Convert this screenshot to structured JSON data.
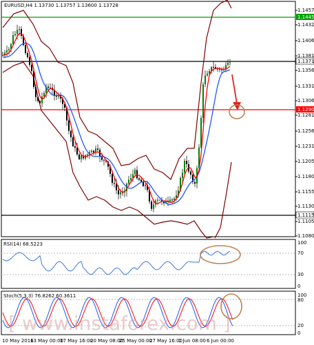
{
  "main_panel": {
    "header": "EURUSD,H4  1.13730 1.13757 1.13600 1.13728",
    "price_labels": [
      "1.14570",
      "1.14320",
      "1.14065",
      "1.13815",
      "1.13565",
      "1.13315",
      "1.13065",
      "1.12810",
      "1.12560",
      "1.12310",
      "1.12055",
      "1.11805",
      "1.11555",
      "1.11300",
      "1.11050",
      "1.10800"
    ],
    "level_green": "1.14454",
    "level_black_top": "1.13713",
    "level_red": "1.12904",
    "level_black_bottom": "1.11150"
  },
  "rsi_panel": {
    "header": "RSI(14) 68.5223",
    "scale": [
      "100",
      "70",
      "30",
      "0"
    ]
  },
  "stoch_panel": {
    "header": "Stoch(5,3,3) 76.8262 60.3611",
    "scale": [
      "100",
      "80",
      "20",
      "0"
    ]
  },
  "time_labels": [
    "10 May 2016",
    "13 May 00:00",
    "17 May 16:00",
    "20 May 08:00",
    "25 May 00:00",
    "27 May 16:00",
    "1 Jun 08:00",
    "6 Jun 00:00"
  ],
  "watermark": "[ www.instaforex.com ]",
  "colors": {
    "candle": "#008000",
    "ma_red": "#ff0000",
    "ma_blue": "#1e56ff",
    "bands": "#800000",
    "green_level": "#00a000",
    "red_level": "#ff0000",
    "annotation": "#c08050",
    "rsi": "#3a78d8"
  }
}
